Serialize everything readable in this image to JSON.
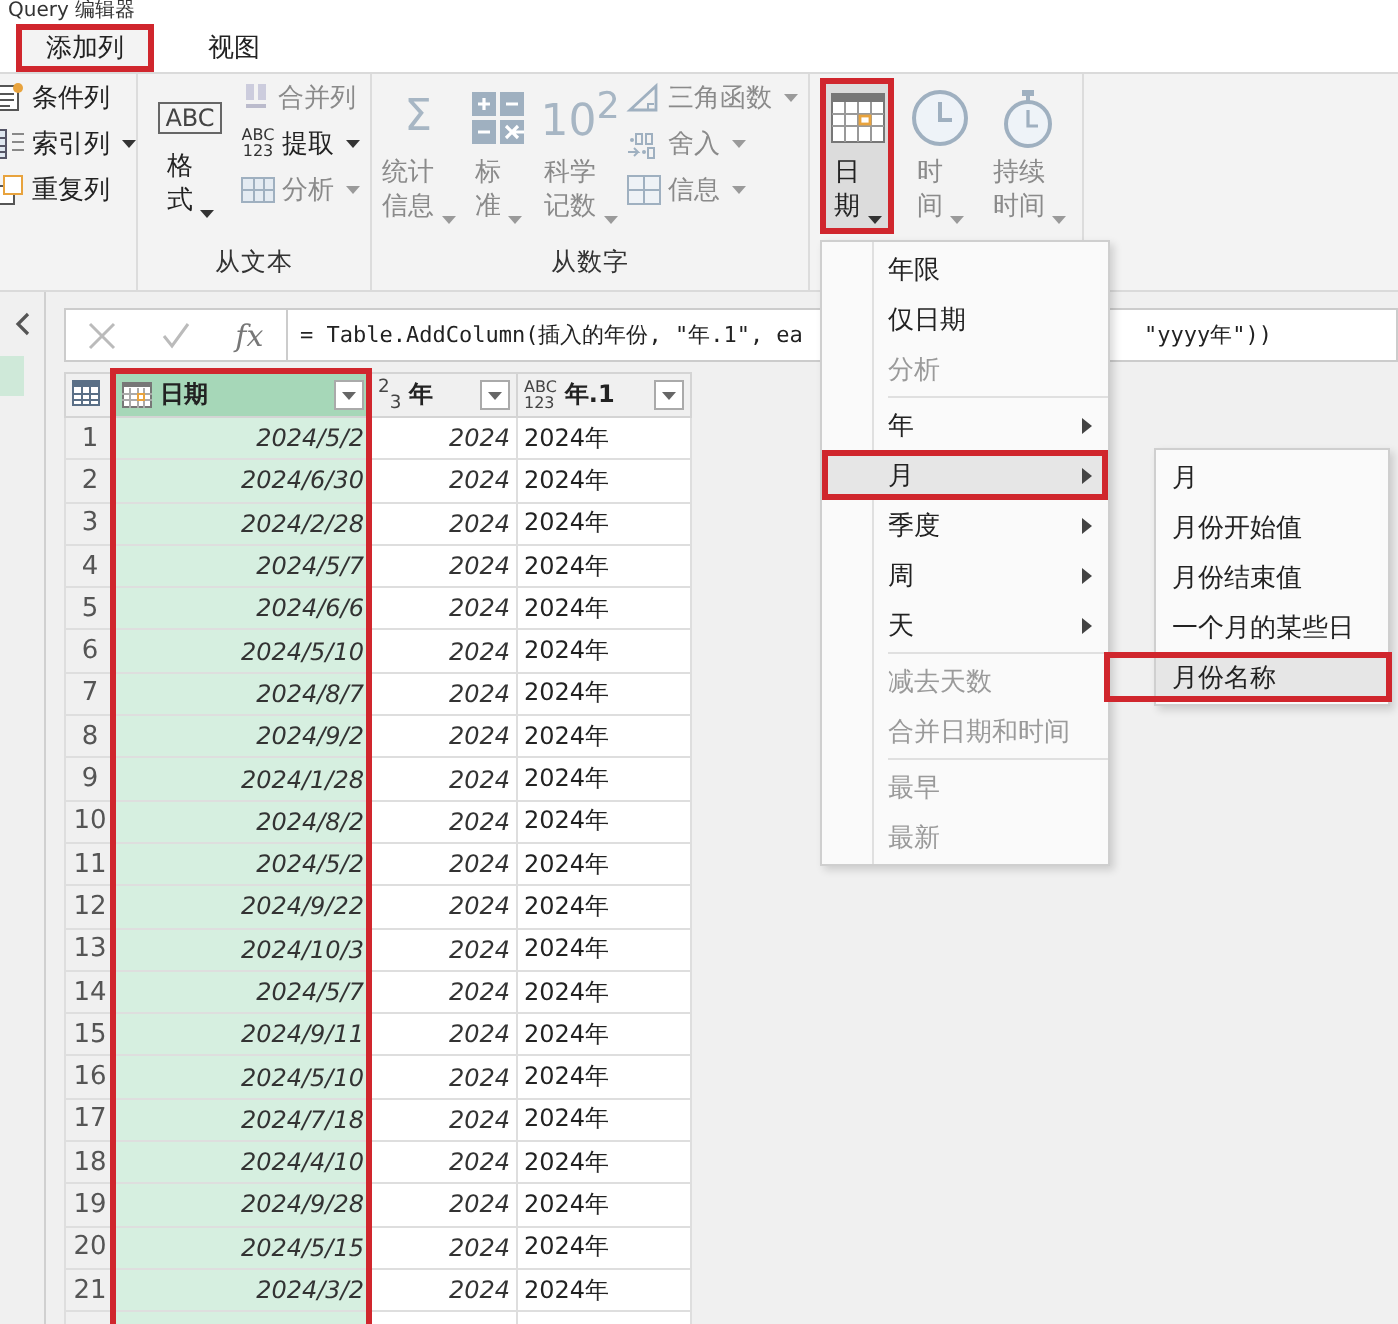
{
  "window": {
    "title": "Query 编辑器"
  },
  "tabs": [
    {
      "label": "添加列",
      "selected": true,
      "highlighted": true
    },
    {
      "label": "视图",
      "selected": false,
      "highlighted": false
    }
  ],
  "ribbon": {
    "groups": [
      {
        "small": [
          {
            "label": "条件列",
            "dropdown": false,
            "disabled": false
          },
          {
            "label": "索引列",
            "dropdown": true,
            "disabled": false
          },
          {
            "label": "重复列",
            "dropdown": false,
            "disabled": false
          }
        ]
      },
      {
        "label": "从文本",
        "large": [
          {
            "label": "格式",
            "icon_text": "ABC",
            "dropdown": true,
            "disabled": false,
            "highlighted": false
          }
        ],
        "small": [
          {
            "label": "合并列",
            "dropdown": false,
            "disabled": true
          },
          {
            "label": "提取",
            "icon_text": "ABC\n123",
            "dropdown": true,
            "disabled": false
          },
          {
            "label": "分析",
            "dropdown": true,
            "disabled": true
          }
        ]
      },
      {
        "label": "从数字",
        "large": [
          {
            "label": "统计信息",
            "icon_text": "Σ",
            "dropdown": true,
            "disabled": true,
            "highlighted": false
          },
          {
            "label": "标准",
            "dropdown": true,
            "disabled": true,
            "highlighted": false
          },
          {
            "label": "科学记数",
            "icon_text": "10$^{2}$",
            "dropdown": true,
            "disabled": true,
            "highlighted": false
          }
        ],
        "small": [
          {
            "label": "三角函数",
            "dropdown": true,
            "disabled": true
          },
          {
            "label": "舍入",
            "dropdown": true,
            "disabled": true
          },
          {
            "label": "信息",
            "dropdown": true,
            "disabled": true
          }
        ]
      },
      {
        "large": [
          {
            "label": "日期",
            "dropdown": true,
            "disabled": false,
            "highlighted": true
          },
          {
            "label": "时间",
            "dropdown": true,
            "disabled": true,
            "highlighted": false
          },
          {
            "label": "持续时间",
            "dropdown": true,
            "disabled": true,
            "highlighted": false
          }
        ]
      }
    ]
  },
  "formula_bar": {
    "fx": "fx",
    "formula_start": "= Table.AddColumn(插入的年份, \"年.1\", ea",
    "formula_end": "\"yyyy年\"))"
  },
  "table": {
    "columns": [
      {
        "name": "日期",
        "selected": true,
        "highlighted": true
      },
      {
        "name": "年",
        "type_label": "$^{2}$$_{3}$",
        "selected": false,
        "highlighted": false
      },
      {
        "name": "年.1",
        "type_label": "ABC\n123",
        "selected": false,
        "highlighted": false
      }
    ],
    "rows": [
      {
        "index": "1",
        "date": "2024/5/2",
        "year": "2024",
        "year_text": "2024年"
      },
      {
        "index": "2",
        "date": "2024/6/30",
        "year": "2024",
        "year_text": "2024年"
      },
      {
        "index": "3",
        "date": "2024/2/28",
        "year": "2024",
        "year_text": "2024年"
      },
      {
        "index": "4",
        "date": "2024/5/7",
        "year": "2024",
        "year_text": "2024年"
      },
      {
        "index": "5",
        "date": "2024/6/6",
        "year": "2024",
        "year_text": "2024年"
      },
      {
        "index": "6",
        "date": "2024/5/10",
        "year": "2024",
        "year_text": "2024年"
      },
      {
        "index": "7",
        "date": "2024/8/7",
        "year": "2024",
        "year_text": "2024年"
      },
      {
        "index": "8",
        "date": "2024/9/2",
        "year": "2024",
        "year_text": "2024年"
      },
      {
        "index": "9",
        "date": "2024/1/28",
        "year": "2024",
        "year_text": "2024年"
      },
      {
        "index": "10",
        "date": "2024/8/2",
        "year": "2024",
        "year_text": "2024年"
      },
      {
        "index": "11",
        "date": "2024/5/2",
        "year": "2024",
        "year_text": "2024年"
      },
      {
        "index": "12",
        "date": "2024/9/22",
        "year": "2024",
        "year_text": "2024年"
      },
      {
        "index": "13",
        "date": "2024/10/3",
        "year": "2024",
        "year_text": "2024年"
      },
      {
        "index": "14",
        "date": "2024/5/7",
        "year": "2024",
        "year_text": "2024年"
      },
      {
        "index": "15",
        "date": "2024/9/11",
        "year": "2024",
        "year_text": "2024年"
      },
      {
        "index": "16",
        "date": "2024/5/10",
        "year": "2024",
        "year_text": "2024年"
      },
      {
        "index": "17",
        "date": "2024/7/18",
        "year": "2024",
        "year_text": "2024年"
      },
      {
        "index": "18",
        "date": "2024/4/10",
        "year": "2024",
        "year_text": "2024年"
      },
      {
        "index": "19",
        "date": "2024/9/28",
        "year": "2024",
        "year_text": "2024年"
      },
      {
        "index": "20",
        "date": "2024/5/15",
        "year": "2024",
        "year_text": "2024年"
      },
      {
        "index": "21",
        "date": "2024/3/2",
        "year": "2024",
        "year_text": "2024年"
      }
    ]
  },
  "date_menu": {
    "groups": [
      [
        {
          "label": "年限",
          "disabled": false,
          "submenu": false,
          "selected": false,
          "highlighted": false
        },
        {
          "label": "仅日期",
          "disabled": false,
          "submenu": false,
          "selected": false,
          "highlighted": false
        },
        {
          "label": "分析",
          "disabled": true,
          "submenu": false,
          "selected": false,
          "highlighted": false
        }
      ],
      [
        {
          "label": "年",
          "disabled": false,
          "submenu": true,
          "selected": false,
          "highlighted": false
        },
        {
          "label": "月",
          "disabled": false,
          "submenu": true,
          "selected": true,
          "highlighted": true
        },
        {
          "label": "季度",
          "disabled": false,
          "submenu": true,
          "selected": false,
          "highlighted": false
        },
        {
          "label": "周",
          "disabled": false,
          "submenu": true,
          "selected": false,
          "highlighted": false
        },
        {
          "label": "天",
          "disabled": false,
          "submenu": true,
          "selected": false,
          "highlighted": false
        }
      ],
      [
        {
          "label": "减去天数",
          "disabled": true,
          "submenu": false,
          "selected": false,
          "highlighted": false
        },
        {
          "label": "合并日期和时间",
          "disabled": true,
          "submenu": false,
          "selected": false,
          "highlighted": false
        }
      ],
      [
        {
          "label": "最早",
          "disabled": true,
          "submenu": false,
          "selected": false,
          "highlighted": false
        },
        {
          "label": "最新",
          "disabled": true,
          "submenu": false,
          "selected": false,
          "highlighted": false
        }
      ]
    ]
  },
  "month_submenu": {
    "items": [
      {
        "label": "月",
        "selected": false,
        "highlighted": false
      },
      {
        "label": "月份开始值",
        "selected": false,
        "highlighted": false
      },
      {
        "label": "月份结束值",
        "selected": false,
        "highlighted": false
      },
      {
        "label": "一个月的某些日",
        "selected": false,
        "highlighted": false
      },
      {
        "label": "月份名称",
        "selected": true,
        "highlighted": true
      }
    ]
  }
}
